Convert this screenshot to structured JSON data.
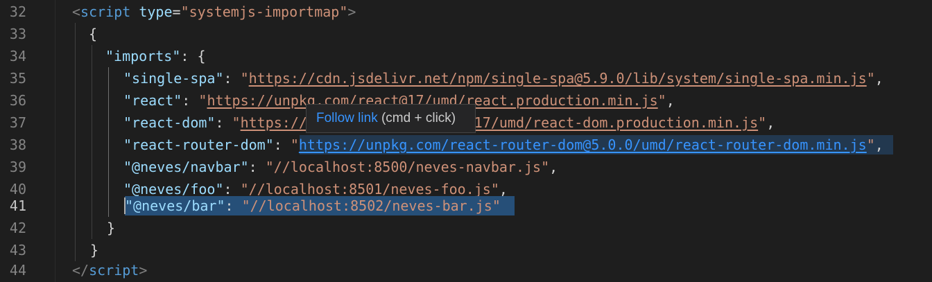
{
  "editor": {
    "lines": [
      {
        "num": "32",
        "tag_open": "<",
        "tag": "script",
        "attr": "type",
        "eq": "=",
        "attr_val": "\"systemjs-importmap\"",
        "tag_close": ">"
      },
      {
        "num": "33",
        "text": "{"
      },
      {
        "num": "34",
        "key": "\"imports\"",
        "rest": ": {"
      },
      {
        "num": "35",
        "key": "\"single-spa\"",
        "sep": ": ",
        "q1": "\"",
        "url": "https://cdn.jsdelivr.net/npm/single-spa@5.9.0/lib/system/single-spa.min.js",
        "q2": "\"",
        "tail": ","
      },
      {
        "num": "36",
        "key": "\"react\"",
        "sep": ": ",
        "q1": "\"",
        "url": "https://unpkg.com/react@17/umd/react.production.min.js",
        "q2": "\"",
        "tail": ","
      },
      {
        "num": "37",
        "key": "\"react-dom\"",
        "sep": ": ",
        "q1": "\"",
        "url": "https://unpkg.com/react-dom@17/umd/react-dom.production.min.js",
        "q2": "\"",
        "tail": ","
      },
      {
        "num": "38",
        "key": "\"react-router-dom\"",
        "sep": ": ",
        "q1": "\"",
        "url": "https://unpkg.com/react-router-dom@5.0.0/umd/react-router-dom.min.js",
        "q2": "\"",
        "tail": ","
      },
      {
        "num": "39",
        "key": "\"@neves/navbar\"",
        "sep": ": ",
        "val": "\"//localhost:8500/neves-navbar.js\"",
        "tail": ","
      },
      {
        "num": "40",
        "key": "\"@neves/foo\"",
        "sep": ": ",
        "val": "\"//localhost:8501/neves-foo.js\"",
        "tail": ","
      },
      {
        "num": "41",
        "key": "\"@neves/bar\"",
        "sep": ": ",
        "val": "\"//localhost:8502/neves-bar.js\""
      },
      {
        "num": "42",
        "text": "}"
      },
      {
        "num": "43",
        "text": "}"
      },
      {
        "num": "44",
        "tag_open": "</",
        "tag": "script",
        "tag_close": ">"
      }
    ],
    "active_line": "41"
  },
  "tooltip": {
    "follow_label": "Follow link",
    "hint": " (cmd + click)"
  },
  "colors": {
    "background": "#1e1e1e",
    "tag": "#569cd6",
    "string": "#ce9178",
    "key": "#9cdcfe",
    "link_active": "#3794ff",
    "selection": "#264f78"
  }
}
